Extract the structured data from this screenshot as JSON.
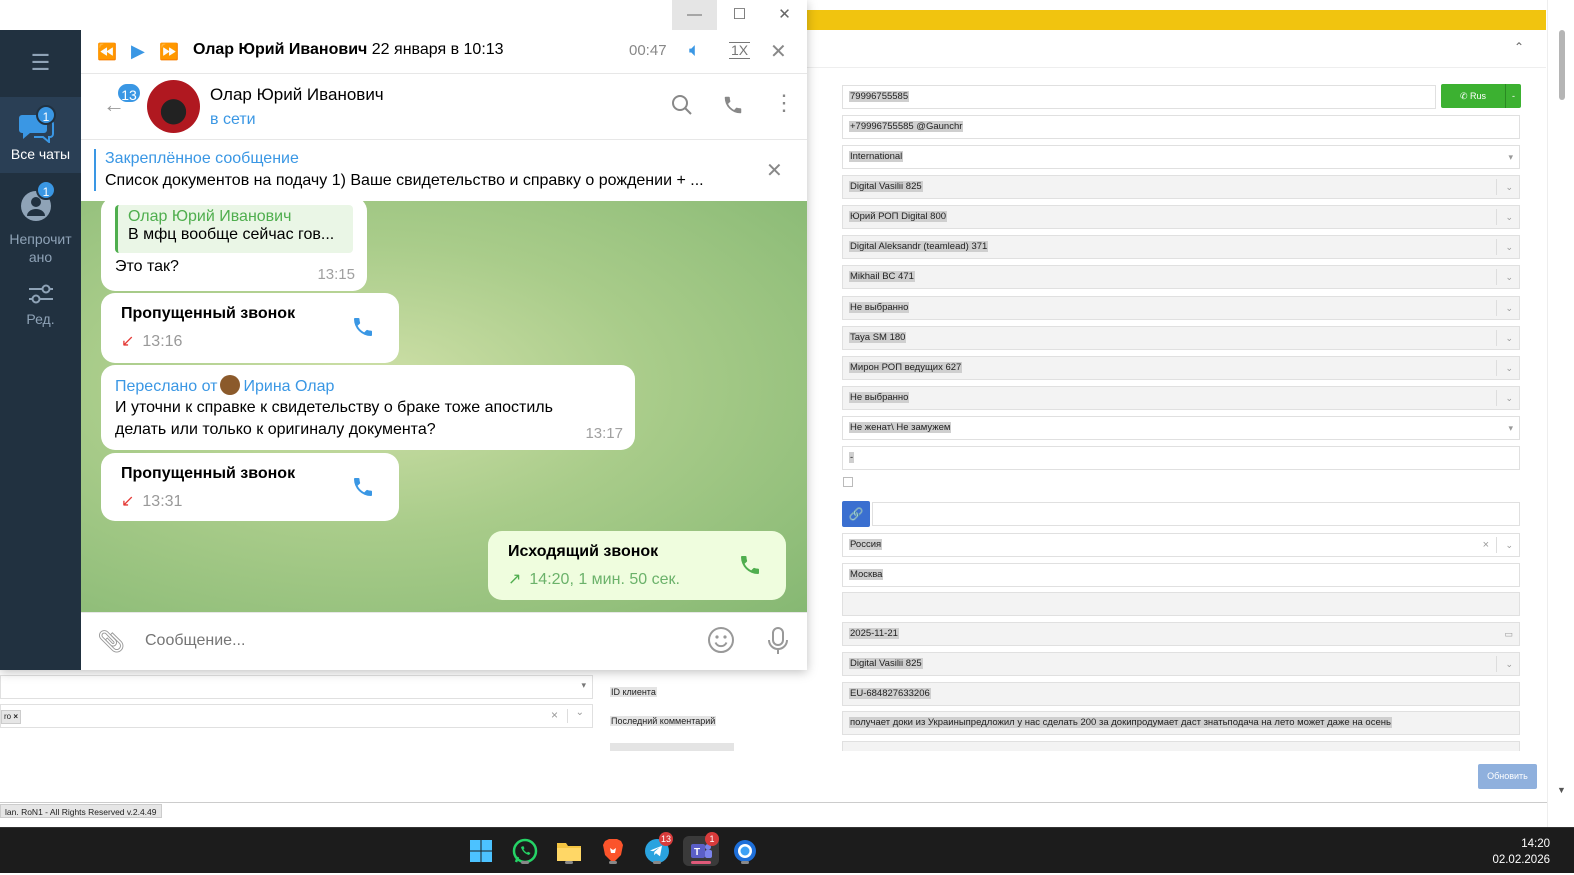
{
  "crm": {
    "fields": [
      {
        "value": "79996755585"
      },
      {
        "value": "+79996755585 @Gaunchr"
      },
      {
        "value": "International"
      },
      {
        "value": "Digital Vasilii 825"
      },
      {
        "value": "Юрий РОП Digital 800"
      },
      {
        "value": "Digital Aleksandr (teamlead) 371"
      },
      {
        "value": "Mikhail BC 471"
      },
      {
        "value": "Не выбранно"
      },
      {
        "value": "Taya SM 180"
      },
      {
        "value": "Мирон РОП ведущих 627"
      },
      {
        "value": "Не выбранно"
      },
      {
        "value": "Не женат\\ Не замужем"
      },
      {
        "value": "-"
      },
      {
        "value": "Россия"
      },
      {
        "value": "Москва"
      },
      {
        "value": ""
      },
      {
        "value": "2025-11-21"
      },
      {
        "value": "Digital Vasilii 825"
      },
      {
        "value": "EU-684827633206"
      },
      {
        "value": "получает доки из Украиныпредложил у нас сделать 200 за докипродумает даст знатьподача на лето может даже на осень"
      }
    ],
    "phone_button": {
      "label": "Rus",
      "extra": "-"
    },
    "labels": {
      "client_id": "ID клиента",
      "last_comment": "Последний комментарий"
    },
    "left_tag": "ro",
    "update_button": "Обновить",
    "footer": "lan. RoN1 - All Rights Reserved v.2.4.49",
    "accent_color": "#f1c40f"
  },
  "telegram": {
    "window_controls": {
      "minimize": "—",
      "maximize": "☐",
      "close": "✕"
    },
    "sidebar": {
      "menu_icon": "hamburger-icon",
      "items": [
        {
          "label": "Все чаты",
          "badge": "1",
          "active": true
        },
        {
          "label": "Непрочитано",
          "label_l1": "Непрочит",
          "label_l2": "ано",
          "badge": "1"
        },
        {
          "label": "Ред.",
          "icon": "filter-settings-icon"
        }
      ]
    },
    "player": {
      "name": "Олар Юрий Иванович",
      "date": "22 января в 10:13",
      "time": "00:47",
      "speed": "1X"
    },
    "chat": {
      "name": "Олар Юрий Иванович",
      "status": "в сети",
      "unread_count": "13"
    },
    "pinned": {
      "title": "Закреплённое сообщение",
      "text": "Список документов на подачу  1) Ваше свидетельство и справку о рождении + ..."
    },
    "messages": {
      "m1": {
        "reply_name": "Олар Юрий Иванович",
        "reply_text": "В мфц вообще сейчас гов...",
        "text": "Это так?",
        "time": "13:15"
      },
      "m2": {
        "title": "Пропущенный звонок",
        "time": "13:16"
      },
      "m3": {
        "forward_prefix": "Переслано от",
        "forward_name": "Ирина Олар",
        "text_l1": "И уточни к справке  к свидетельству о браке тоже апостиль",
        "text_l2": "делать или только к оригиналу документа?",
        "time": "13:17"
      },
      "m4": {
        "title": "Пропущенный звонок",
        "time": "13:31"
      },
      "m5": {
        "title": "Исходящий звонок",
        "time": "14:20, 1 мин. 50 сек."
      }
    },
    "composer": {
      "placeholder": "Сообщение..."
    },
    "accent_color": "#3a97e4"
  },
  "taskbar": {
    "telegram_badge": "13",
    "teams_badge": "1",
    "time": "14:20",
    "date": "02.02.2026"
  }
}
